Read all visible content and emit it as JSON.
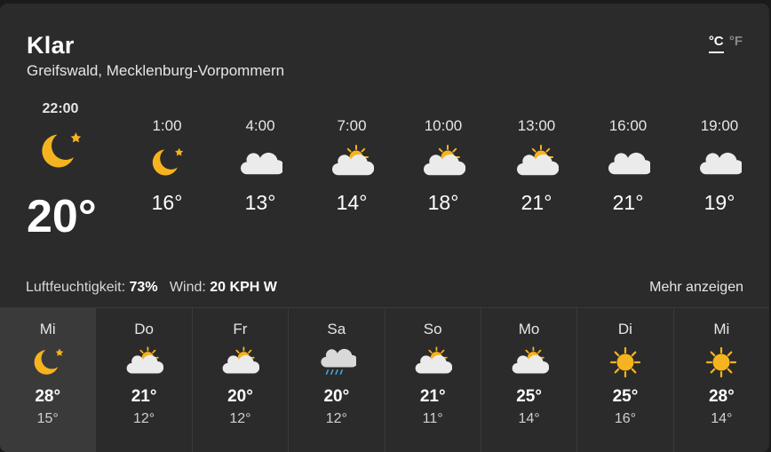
{
  "header": {
    "condition": "Klar",
    "location": "Greifswald, Mecklenburg-Vorpommern",
    "unit_c": "°C",
    "unit_f": "°F"
  },
  "current": {
    "time": "22:00",
    "icon": "moon-star-icon",
    "temp": "20°"
  },
  "hourly": [
    {
      "time": "1:00",
      "icon": "moon-star-icon",
      "temp": "16°"
    },
    {
      "time": "4:00",
      "icon": "cloud-icon",
      "temp": "13°"
    },
    {
      "time": "7:00",
      "icon": "sun-cloud-icon",
      "temp": "14°"
    },
    {
      "time": "10:00",
      "icon": "sun-cloud-icon",
      "temp": "18°"
    },
    {
      "time": "13:00",
      "icon": "sun-cloud-icon",
      "temp": "21°"
    },
    {
      "time": "16:00",
      "icon": "cloud-icon",
      "temp": "21°"
    },
    {
      "time": "19:00",
      "icon": "cloud-icon",
      "temp": "19°"
    }
  ],
  "details": {
    "humidity_label": "Luftfeuchtigkeit:",
    "humidity_value": "73%",
    "wind_label": "Wind:",
    "wind_value": "20 KPH W",
    "more_label": "Mehr anzeigen"
  },
  "daily": [
    {
      "day": "Mi",
      "icon": "moon-star-icon",
      "high": "28°",
      "low": "15°"
    },
    {
      "day": "Do",
      "icon": "sun-cloud-icon",
      "high": "21°",
      "low": "12°"
    },
    {
      "day": "Fr",
      "icon": "sun-cloud-icon",
      "high": "20°",
      "low": "12°"
    },
    {
      "day": "Sa",
      "icon": "rain-cloud-icon",
      "high": "20°",
      "low": "12°"
    },
    {
      "day": "So",
      "icon": "sun-cloud-icon",
      "high": "21°",
      "low": "11°"
    },
    {
      "day": "Mo",
      "icon": "sun-cloud-icon",
      "high": "25°",
      "low": "14°"
    },
    {
      "day": "Di",
      "icon": "sun-icon",
      "high": "25°",
      "low": "16°"
    },
    {
      "day": "Mi",
      "icon": "sun-icon",
      "high": "28°",
      "low": "14°"
    }
  ],
  "colors": {
    "background": "#2b2b2b",
    "selected_day": "#3a3a3a",
    "sun": "#f5b31f",
    "cloud": "#ebebeb",
    "rain": "#4aa3df"
  }
}
